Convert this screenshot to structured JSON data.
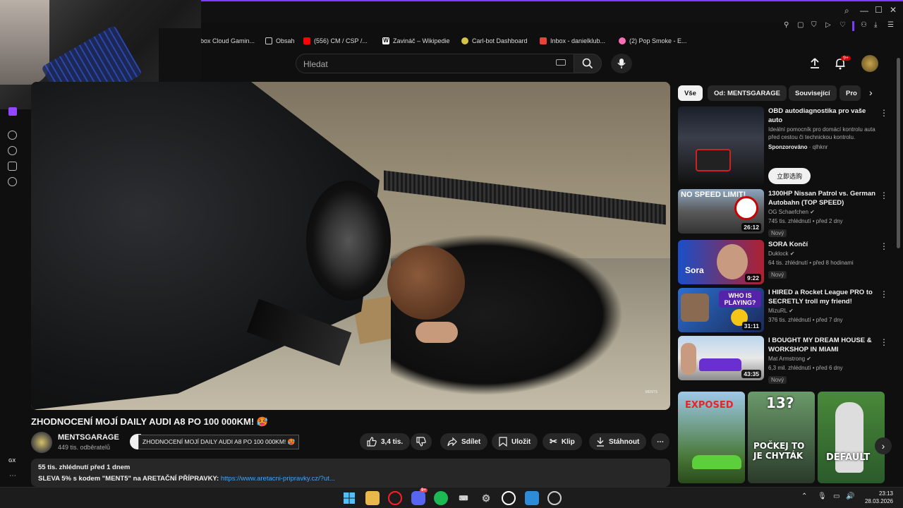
{
  "bookmarks": [
    {
      "label": "box Cloud Gamin...",
      "icon": "page-icon",
      "color": "#777777"
    },
    {
      "label": "Obsah",
      "icon": "page-icon",
      "color": "#cccccc"
    },
    {
      "label": "(556) CM / CSP /...",
      "icon": "youtube-icon",
      "color": "#ff0000"
    },
    {
      "label": "Zavináč – Wikipedie",
      "icon": "wikipedia-icon",
      "color": "#ffffff"
    },
    {
      "label": "Carl-bot Dashboard",
      "icon": "carlbot-icon",
      "color": "#d4c44a"
    },
    {
      "label": "Inbox - danielklub...",
      "icon": "gmail-icon",
      "color": "#ea4335"
    },
    {
      "label": "(2) Pop Smoke - E...",
      "icon": "music-icon",
      "color": "#ff6fb5"
    }
  ],
  "search": {
    "placeholder": "Hledat"
  },
  "header": {
    "notification_count": "9+"
  },
  "video": {
    "title": "ZHODNOCENÍ MOJÍ DAILY AUDI A8 PO 100 000KM! 🥵",
    "watermark": "MENTS",
    "channel_name": "MENTSGARAGE",
    "channel_subs": "449 tis. odběratelů",
    "tooltip": "ZHODNOCENÍ MOJÍ DAILY AUDI A8 PO 100 000KM! 🥵",
    "likes": "3,4 tis.",
    "share": "Sdílet",
    "save": "Uložit",
    "clip": "Klip",
    "download": "Stáhnout",
    "desc_stats": "55 tis. zhlédnutí  před 1 dnem",
    "desc_promo": "SLEVA 5% s kodem \"MENT5\"  na ARETAČNÍ PŘÍPRAVKY: ",
    "desc_link": "https://www.aretacni-pripravky.cz/?ut..."
  },
  "chips": [
    "Vše",
    "Od: MENTSGARAGE",
    "Související",
    "Pro"
  ],
  "ad": {
    "title": "OBD autodiagnostika pro vaše auto",
    "desc": "Ideální pomocník pro domácí kontrolu auta před cestou či technickou kontrolu.",
    "sponsored": "Sponzorováno",
    "advertiser": "qlhknr",
    "cta": "立即选购"
  },
  "recommendations": [
    {
      "title": "1300HP Nissan Patrol vs. German Autobahn (TOP SPEED)",
      "channel": "OG Schaefchen",
      "meta": "745 tis. zhlédnutí • před 2 dny",
      "badge": "Nový",
      "duration": "26:12",
      "thumb_text": "NO SPEED LIMIT!"
    },
    {
      "title": "SORA Končí",
      "channel": "Duklock",
      "meta": "64 tis. zhlédnutí • před 8 hodinami",
      "badge": "Nový",
      "duration": "9:22",
      "thumb_text": "Sora"
    },
    {
      "title": "I HIRED a Rocket League PRO to SECRETLY troll my friend!",
      "channel": "MizuRL",
      "meta": "376 tis. zhlédnutí • před 7 dny",
      "badge": "",
      "duration": "31:11",
      "thumb_text": "WHO IS PLAYING?"
    },
    {
      "title": "I BOUGHT MY DREAM HOUSE & WORKSHOP IN MIAMI",
      "channel": "Mat Armstrong",
      "meta": "6,3 mil. zhlédnutí • před 6 dny",
      "badge": "Nový",
      "duration": "43:35",
      "thumb_text": ""
    }
  ],
  "shorts": [
    {
      "text": "EXPOSED"
    },
    {
      "text": "13?",
      "text2": "POČKEJ TO JE CHYTÁK"
    },
    {
      "text": "DEFAULT"
    }
  ],
  "left_rail": {
    "label": "GX"
  },
  "taskbar": {
    "time": "23:13",
    "date": "28.03.2026",
    "discord_badge": "9+"
  }
}
